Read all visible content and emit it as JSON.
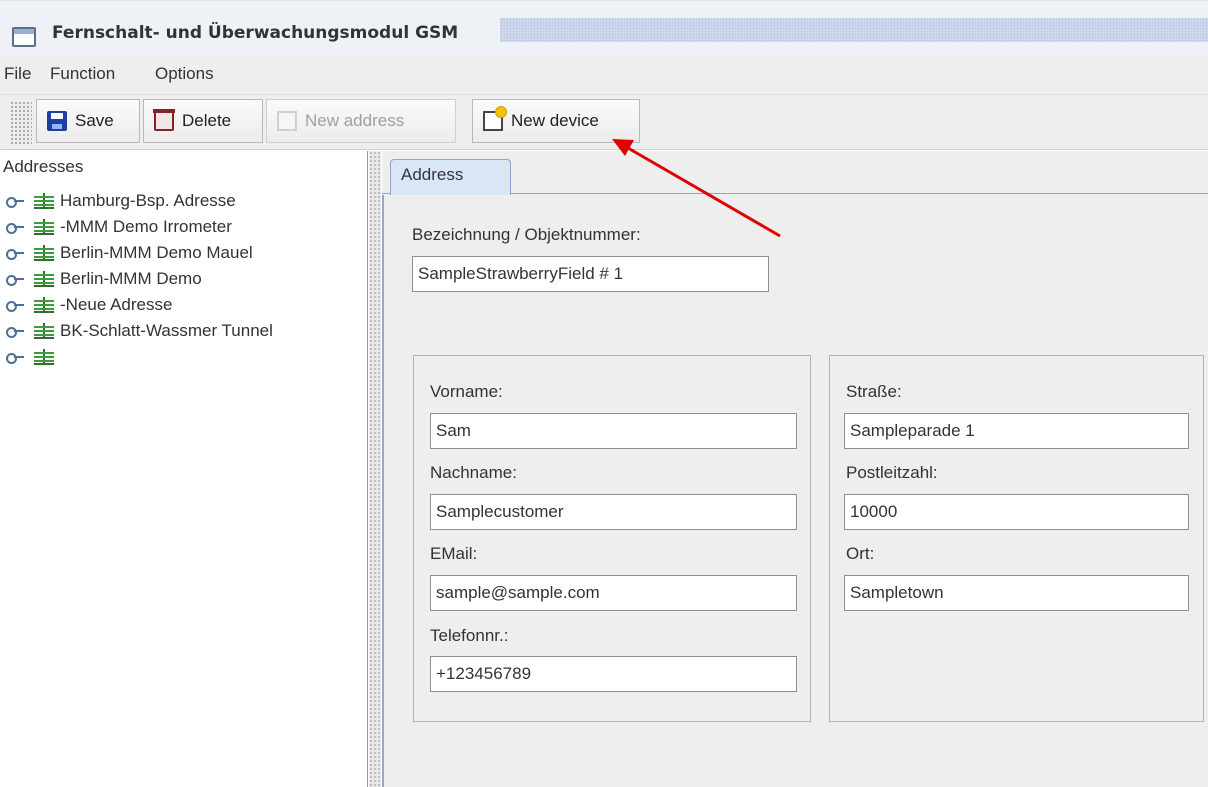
{
  "window": {
    "title": "Fernschalt- und Überwachungsmodul GSM"
  },
  "menubar": {
    "items": [
      "File",
      "Function",
      "Options"
    ]
  },
  "toolbar": {
    "save_label": "Save",
    "delete_label": "Delete",
    "new_address_label": "New address",
    "new_device_label": "New device"
  },
  "tree": {
    "root_label": "Addresses",
    "items": [
      {
        "label": "Hamburg-Bsp. Adresse"
      },
      {
        "label": "-MMM Demo Irrometer"
      },
      {
        "label": "Berlin-MMM Demo Mauel"
      },
      {
        "label": "Berlin-MMM Demo"
      },
      {
        "label": "-Neue Adresse"
      },
      {
        "label": "BK-Schlatt-Wassmer Tunnel"
      },
      {
        "label": ""
      }
    ]
  },
  "tabs": [
    {
      "label": "Address"
    }
  ],
  "form": {
    "object_label": "Bezeichnung / Objektnummer:",
    "object_value": "SampleStrawberryField # 1",
    "left": {
      "firstname_label": "Vorname:",
      "firstname_value": "Sam",
      "lastname_label": "Nachname:",
      "lastname_value": "Samplecustomer",
      "email_label": "EMail:",
      "email_value": "sample@sample.com",
      "phone_label": "Telefonnr.:",
      "phone_value": "+123456789"
    },
    "right": {
      "street_label": "Straße:",
      "street_value": "Sampleparade 1",
      "zip_label": "Postleitzahl:",
      "zip_value": "10000",
      "city_label": "Ort:",
      "city_value": "Sampletown"
    }
  },
  "annotation": {
    "arrow_color": "#e00000",
    "points_to": "new-device-button"
  },
  "colors": {
    "tab_active": "#d9e6f5",
    "tab_border": "#8fa8c8",
    "tree_icon": "#3f9a3f"
  },
  "icons": [
    "app-window-icon",
    "floppy-disk-icon",
    "delete-icon",
    "document-icon",
    "new-document-icon",
    "key-icon",
    "address-book-icon"
  ]
}
